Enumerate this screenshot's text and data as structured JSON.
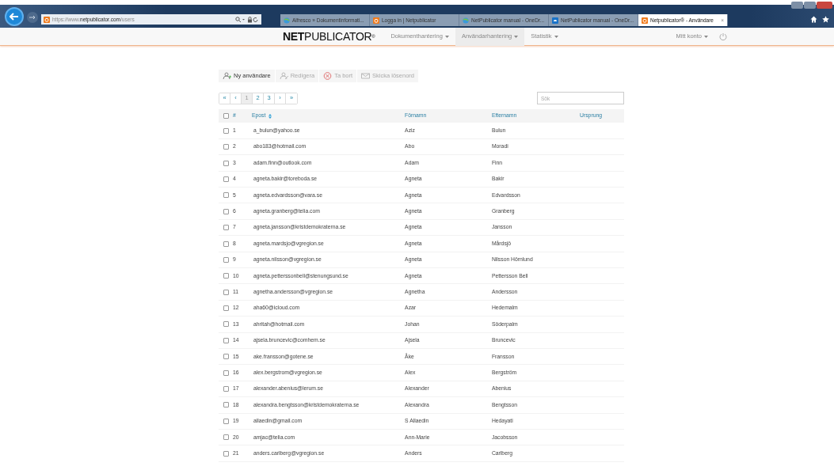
{
  "browser": {
    "address": "https://www.**netpublicator.com**/users",
    "tabs": [
      {
        "title": "Alfresco » Dokumentinformati...",
        "selected": false
      },
      {
        "title": "Logga in | Netpublicator",
        "selected": false
      },
      {
        "title": "NetPublicator manual - OneDr...",
        "selected": false
      },
      {
        "title": "NetPublicator manual - OneDr...",
        "selected": false
      },
      {
        "title": "Netpublicator® - Användare",
        "selected": true,
        "close": "×"
      }
    ]
  },
  "nav": {
    "logo": "**NET**PUBLICATOR$^{®}$",
    "items": [
      {
        "label": "Dokumenthantering",
        "selected": false
      },
      {
        "label": "Användarhantering",
        "selected": true
      },
      {
        "label": "Statistik",
        "selected": false
      }
    ],
    "account": "Mitt konto"
  },
  "toolbar": [
    {
      "label": "Ny användare",
      "disabled": false
    },
    {
      "label": "Redigera",
      "disabled": true
    },
    {
      "label": "Ta bort",
      "disabled": true
    },
    {
      "label": "Skicka lösenord",
      "disabled": true
    }
  ],
  "pagination": [
    {
      "label": "«",
      "selected": false
    },
    {
      "label": "‹",
      "selected": false
    },
    {
      "label": "1",
      "selected": true
    },
    {
      "label": "2",
      "selected": false
    },
    {
      "label": "3",
      "selected": false
    },
    {
      "label": "›",
      "selected": false
    },
    {
      "label": "»",
      "selected": false
    }
  ],
  "search": {
    "placeholder": "Sök"
  },
  "table": {
    "select_all": false,
    "columns": [
      "#",
      "Epost",
      "Förnamn",
      "Efternamn",
      "Ursprung"
    ],
    "rows": [
      {
        "checked": false,
        "cells": [
          "1",
          "a_bulun@yahoo.se",
          "Aziz",
          "Bulun"
        ]
      },
      {
        "checked": false,
        "cells": [
          "2",
          "abo183@hotmail.com",
          "Abo",
          "Moradi"
        ]
      },
      {
        "checked": false,
        "cells": [
          "3",
          "adam.finn@outlook.com",
          "Adam",
          "Finn"
        ]
      },
      {
        "checked": false,
        "cells": [
          "4",
          "agneta.bakir@toreboda.se",
          "Agneta",
          "Bakir"
        ]
      },
      {
        "checked": false,
        "cells": [
          "5",
          "agneta.edvardsson@vara.se",
          "Agneta",
          "Edvardsson"
        ]
      },
      {
        "checked": false,
        "cells": [
          "6",
          "agneta.granberg@telia.com",
          "Agneta",
          "Granberg"
        ]
      },
      {
        "checked": false,
        "cells": [
          "7",
          "agneta.jansson@kristdemokraterna.se",
          "Agneta",
          "Jansson"
        ]
      },
      {
        "checked": false,
        "cells": [
          "8",
          "agneta.mardsjo@vgregion.se",
          "Agneta",
          "Mårdsjö"
        ]
      },
      {
        "checked": false,
        "cells": [
          "9",
          "agneta.nilsson@vgregion.se",
          "Agneta",
          "Nilsson Hörnlund"
        ]
      },
      {
        "checked": false,
        "cells": [
          "10",
          "agneta.petterssonbell@stenungsund.se",
          "Agneta",
          "Pettersson Bell"
        ]
      },
      {
        "checked": false,
        "cells": [
          "11",
          "agnetha.andersson@vgregion.se",
          "Agnetha",
          "Andersson"
        ]
      },
      {
        "checked": false,
        "cells": [
          "12",
          "aha60@icloud.com",
          "Azar",
          "Hedemalm"
        ]
      },
      {
        "checked": false,
        "cells": [
          "13",
          "ahritah@hotmail.com",
          "Johan",
          "Söderpalm"
        ]
      },
      {
        "checked": false,
        "cells": [
          "14",
          "ajsela.bruncevic@comhem.se",
          "Ajsela",
          "Bruncevic"
        ]
      },
      {
        "checked": false,
        "cells": [
          "15",
          "ake.fransson@gotene.se",
          "Åke",
          "Fransson"
        ]
      },
      {
        "checked": false,
        "cells": [
          "16",
          "alex.bergstrom@vgregion.se",
          "Alex",
          "Bergström"
        ]
      },
      {
        "checked": false,
        "cells": [
          "17",
          "alexander.abenius@lerum.se",
          "Alexander",
          "Abenius"
        ]
      },
      {
        "checked": false,
        "cells": [
          "18",
          "alexandra.bengtsson@kristdemokraterna.se",
          "Alexandra",
          "Bengtsson"
        ]
      },
      {
        "checked": false,
        "cells": [
          "19",
          "allaedin@gmail.com",
          "S Allaedin",
          "Hedayati"
        ]
      },
      {
        "checked": false,
        "cells": [
          "20",
          "amjac@telia.com",
          "Ann-Marie",
          "Jacobsson"
        ]
      },
      {
        "checked": false,
        "cells": [
          "21",
          "anders.carlberg@vgregion.se",
          "Anders",
          "Carlberg"
        ]
      }
    ]
  }
}
